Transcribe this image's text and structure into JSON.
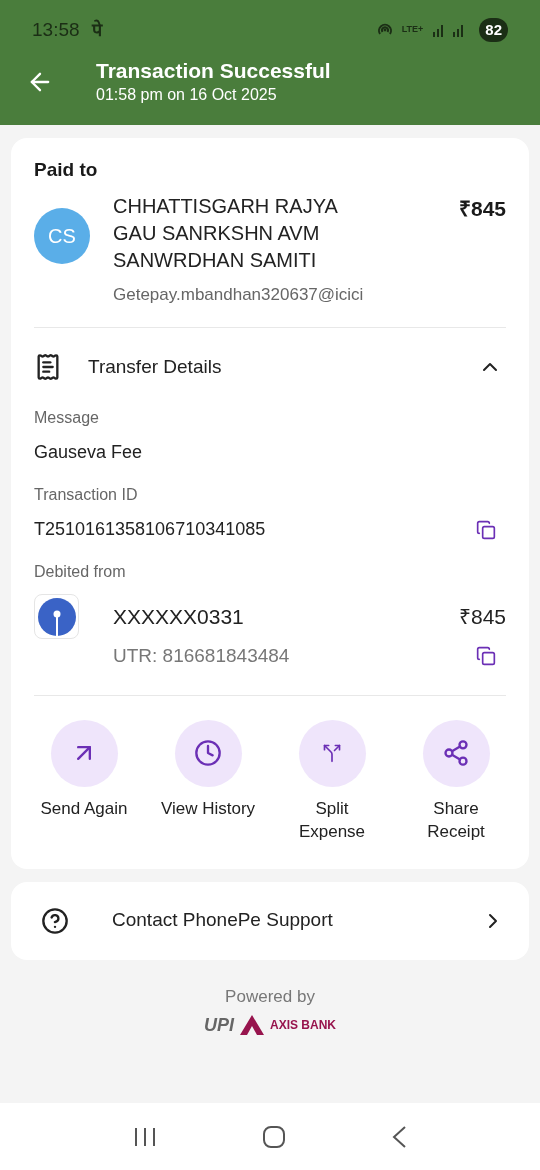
{
  "status_bar": {
    "time": "13:58",
    "notification": "पे",
    "network": "LTE+",
    "battery": "82"
  },
  "header": {
    "title": "Transaction Successful",
    "subtitle": "01:58 pm on 16 Oct 2025"
  },
  "paid_to": {
    "label": "Paid to",
    "initials": "CS",
    "name": "CHHATTISGARH RAJYA GAU SANRKSHN AVM SANWRDHAN SAMITI",
    "amount": "₹845",
    "upi_id": "Getepay.mbandhan320637@icici"
  },
  "transfer_details": {
    "title": "Transfer Details",
    "expanded": true,
    "fields": [
      {
        "label": "Message",
        "value": "Gauseva Fee",
        "copyable": false
      },
      {
        "label": "Transaction ID",
        "value": "T2510161358106710341085",
        "copyable": true
      }
    ],
    "debited_from": {
      "label": "Debited from",
      "account": "XXXXXX0331",
      "amount": "₹845",
      "utr": "UTR: 816681843484"
    }
  },
  "actions": [
    {
      "kind": "send",
      "label": "Send Again"
    },
    {
      "kind": "history",
      "label": "View History"
    },
    {
      "kind": "split",
      "label": "Split Expense"
    },
    {
      "kind": "share",
      "label": "Share Receipt"
    }
  ],
  "support": {
    "label": "Contact PhonePe Support"
  },
  "footer": {
    "powered_by": "Powered by",
    "logos": [
      "UPI",
      "AXIS BANK"
    ]
  }
}
